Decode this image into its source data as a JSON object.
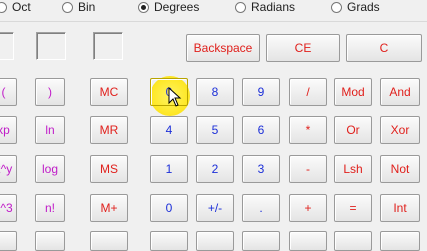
{
  "radix": [
    {
      "label": "Oct",
      "selected": false
    },
    {
      "label": "Bin",
      "selected": false
    }
  ],
  "angle_units": [
    {
      "label": "Degrees",
      "selected": true
    },
    {
      "label": "Radians",
      "selected": false
    },
    {
      "label": "Grads",
      "selected": false
    }
  ],
  "top_row": {
    "backspace": "Backspace",
    "ce": "CE",
    "c": "C"
  },
  "left_col_a": [
    "(",
    "xp",
    "x^y",
    "x^3",
    ""
  ],
  "left_col_b": [
    ")",
    "ln",
    "log",
    "n!",
    ""
  ],
  "memory": [
    "MC",
    "MR",
    "MS",
    "M+"
  ],
  "digits": {
    "r1": [
      "0",
      "8",
      "9"
    ],
    "r2": [
      "4",
      "5",
      "6"
    ],
    "r3": [
      "1",
      "2",
      "3"
    ],
    "r4": [
      "0",
      "+/-",
      "."
    ]
  },
  "ops": {
    "r1": [
      "/",
      "Mod",
      "And"
    ],
    "r2": [
      "*",
      "Or",
      "Xor"
    ],
    "r3": [
      "-",
      "Lsh",
      "Not"
    ],
    "r4": [
      "+",
      "=",
      "Int"
    ]
  },
  "colors": {
    "operator": "#e0201c",
    "digit": "#1c2fd8",
    "function": "#c01cc8",
    "highlight": "#ffe820"
  }
}
